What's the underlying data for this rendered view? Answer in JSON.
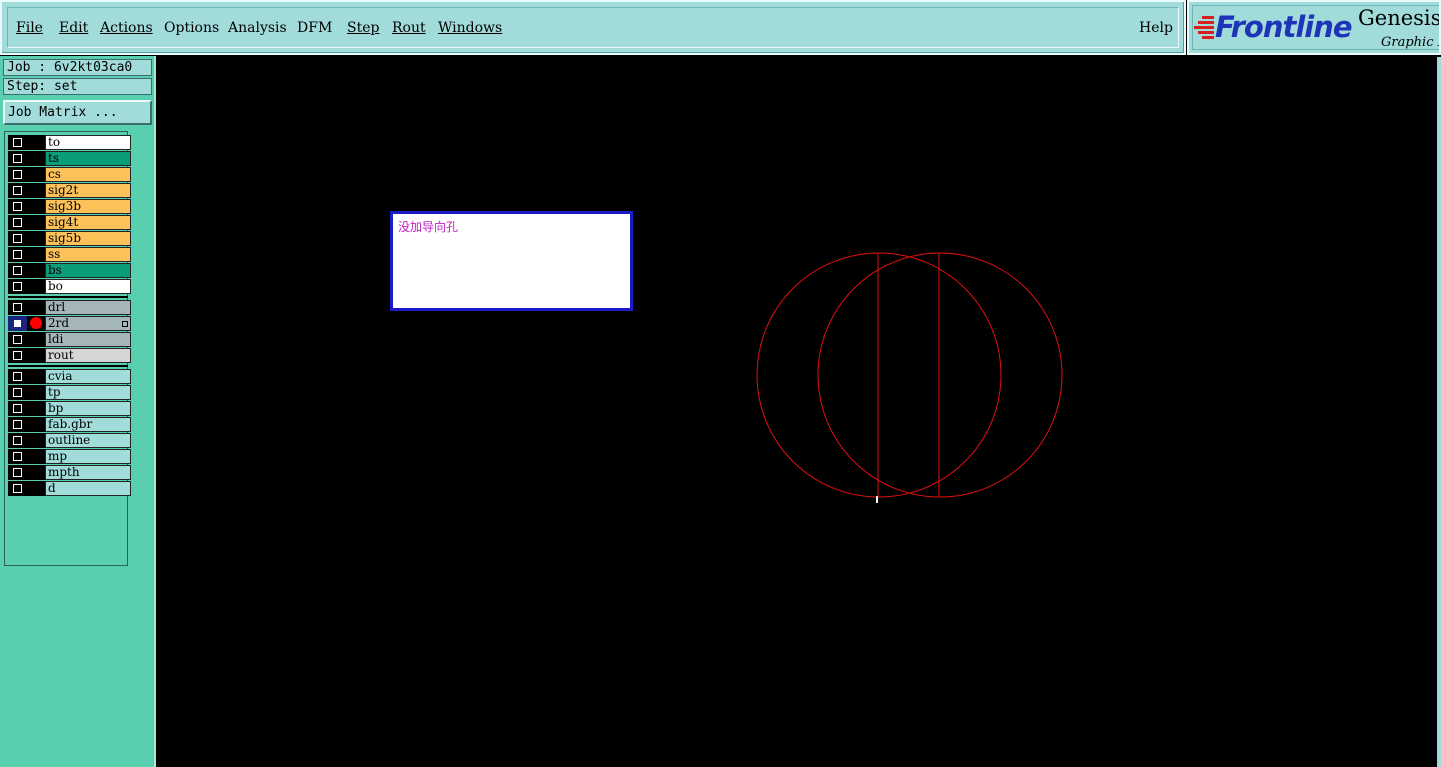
{
  "menu": {
    "items": [
      "File",
      "Edit",
      "Actions",
      "Options",
      "Analysis",
      "DFM",
      "Step",
      "Rout",
      "Windows"
    ],
    "help": "Help"
  },
  "logo": {
    "brand": "Frontline",
    "product": "Genesis",
    "tagline": "Graphic E"
  },
  "job": {
    "job_label": "Job : 6v2kt03ca0",
    "step_label": "Step: set",
    "matrix_button": "Job Matrix ..."
  },
  "layers": {
    "group1": [
      {
        "name": "to",
        "color": "#ffffff"
      },
      {
        "name": "ts",
        "color": "#0a9d7a"
      },
      {
        "name": "cs",
        "color": "#ffc25a"
      },
      {
        "name": "sig2t",
        "color": "#ffc25a"
      },
      {
        "name": "sig3b",
        "color": "#ffc25a"
      },
      {
        "name": "sig4t",
        "color": "#ffc25a"
      },
      {
        "name": "sig5b",
        "color": "#ffc25a"
      },
      {
        "name": "ss",
        "color": "#ffc25a"
      },
      {
        "name": "bs",
        "color": "#0a9d7a"
      },
      {
        "name": "bo",
        "color": "#ffffff"
      }
    ],
    "group2": [
      {
        "name": "drl",
        "color": "#a4b6ba",
        "active": false
      },
      {
        "name": "2rd",
        "color": "#a4b6ba",
        "active": true
      },
      {
        "name": "ldi",
        "color": "#a4b6ba",
        "active": false
      },
      {
        "name": "rout",
        "color": "#d6d6d6",
        "active": false
      }
    ],
    "group3": [
      {
        "name": "cvia",
        "color": "#a1dcdb"
      },
      {
        "name": "tp",
        "color": "#a1dcdb"
      },
      {
        "name": "bp",
        "color": "#a1dcdb"
      },
      {
        "name": "fab.gbr",
        "color": "#a1dcdb"
      },
      {
        "name": "outline",
        "color": "#a1dcdb"
      },
      {
        "name": "mp",
        "color": "#a1dcdb"
      },
      {
        "name": "mpth",
        "color": "#a1dcdb"
      },
      {
        "name": "d",
        "color": "#a1dcdb"
      }
    ]
  },
  "popup": {
    "message": "没加导向孔"
  },
  "colors": {
    "panel": "#58d0b0",
    "menubar": "#a1dcdb",
    "drawing": "#e01010",
    "logo_blue": "#1e35b9"
  }
}
